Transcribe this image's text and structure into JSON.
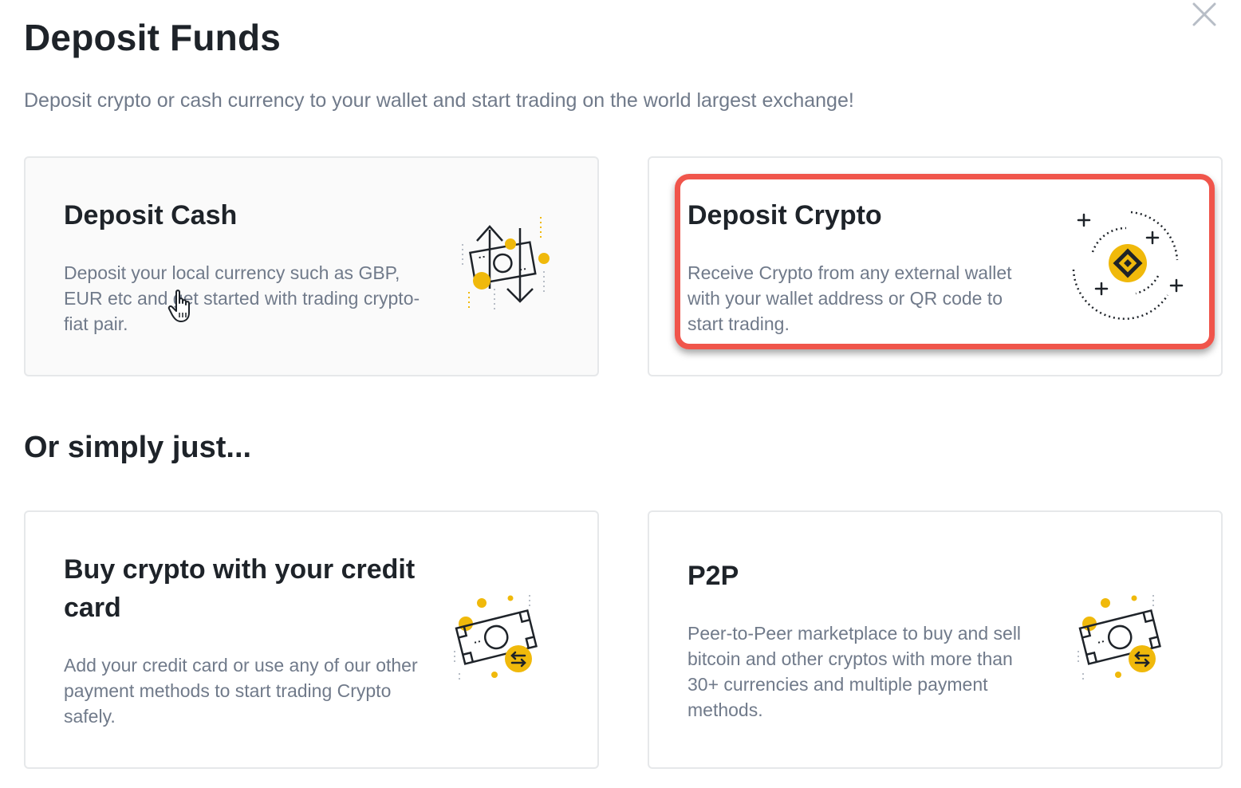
{
  "header": {
    "title": "Deposit Funds",
    "subtitle": "Deposit crypto or cash currency to your wallet and start trading on the world largest exchange!",
    "close_icon": "close-icon"
  },
  "cards": {
    "deposit_cash": {
      "title": "Deposit Cash",
      "description": "Deposit your local currency such as GBP, EUR etc and get started with trading crypto-fiat pair.",
      "icon": "cash-transfer-icon"
    },
    "deposit_crypto": {
      "title": "Deposit Crypto",
      "description": "Receive Crypto from any external wallet with your wallet address or QR code to start trading.",
      "icon": "binance-coin-icon"
    }
  },
  "alternatives": {
    "title": "Or simply just...",
    "credit_card": {
      "title": "Buy crypto with your credit card",
      "description": "Add your credit card or use any of our other payment methods to start trading Crypto safely.",
      "icon": "cash-exchange-icon"
    },
    "p2p": {
      "title": "P2P",
      "description": "Peer-to-Peer marketplace to buy and sell bitcoin and other cryptos with more than 30+ currencies and multiple payment methods.",
      "icon": "cash-exchange-icon"
    }
  },
  "colors": {
    "accent_yellow": "#f0b90b",
    "highlight_red": "#f0554b",
    "text_primary": "#1e2329",
    "text_secondary": "#707a8a"
  }
}
